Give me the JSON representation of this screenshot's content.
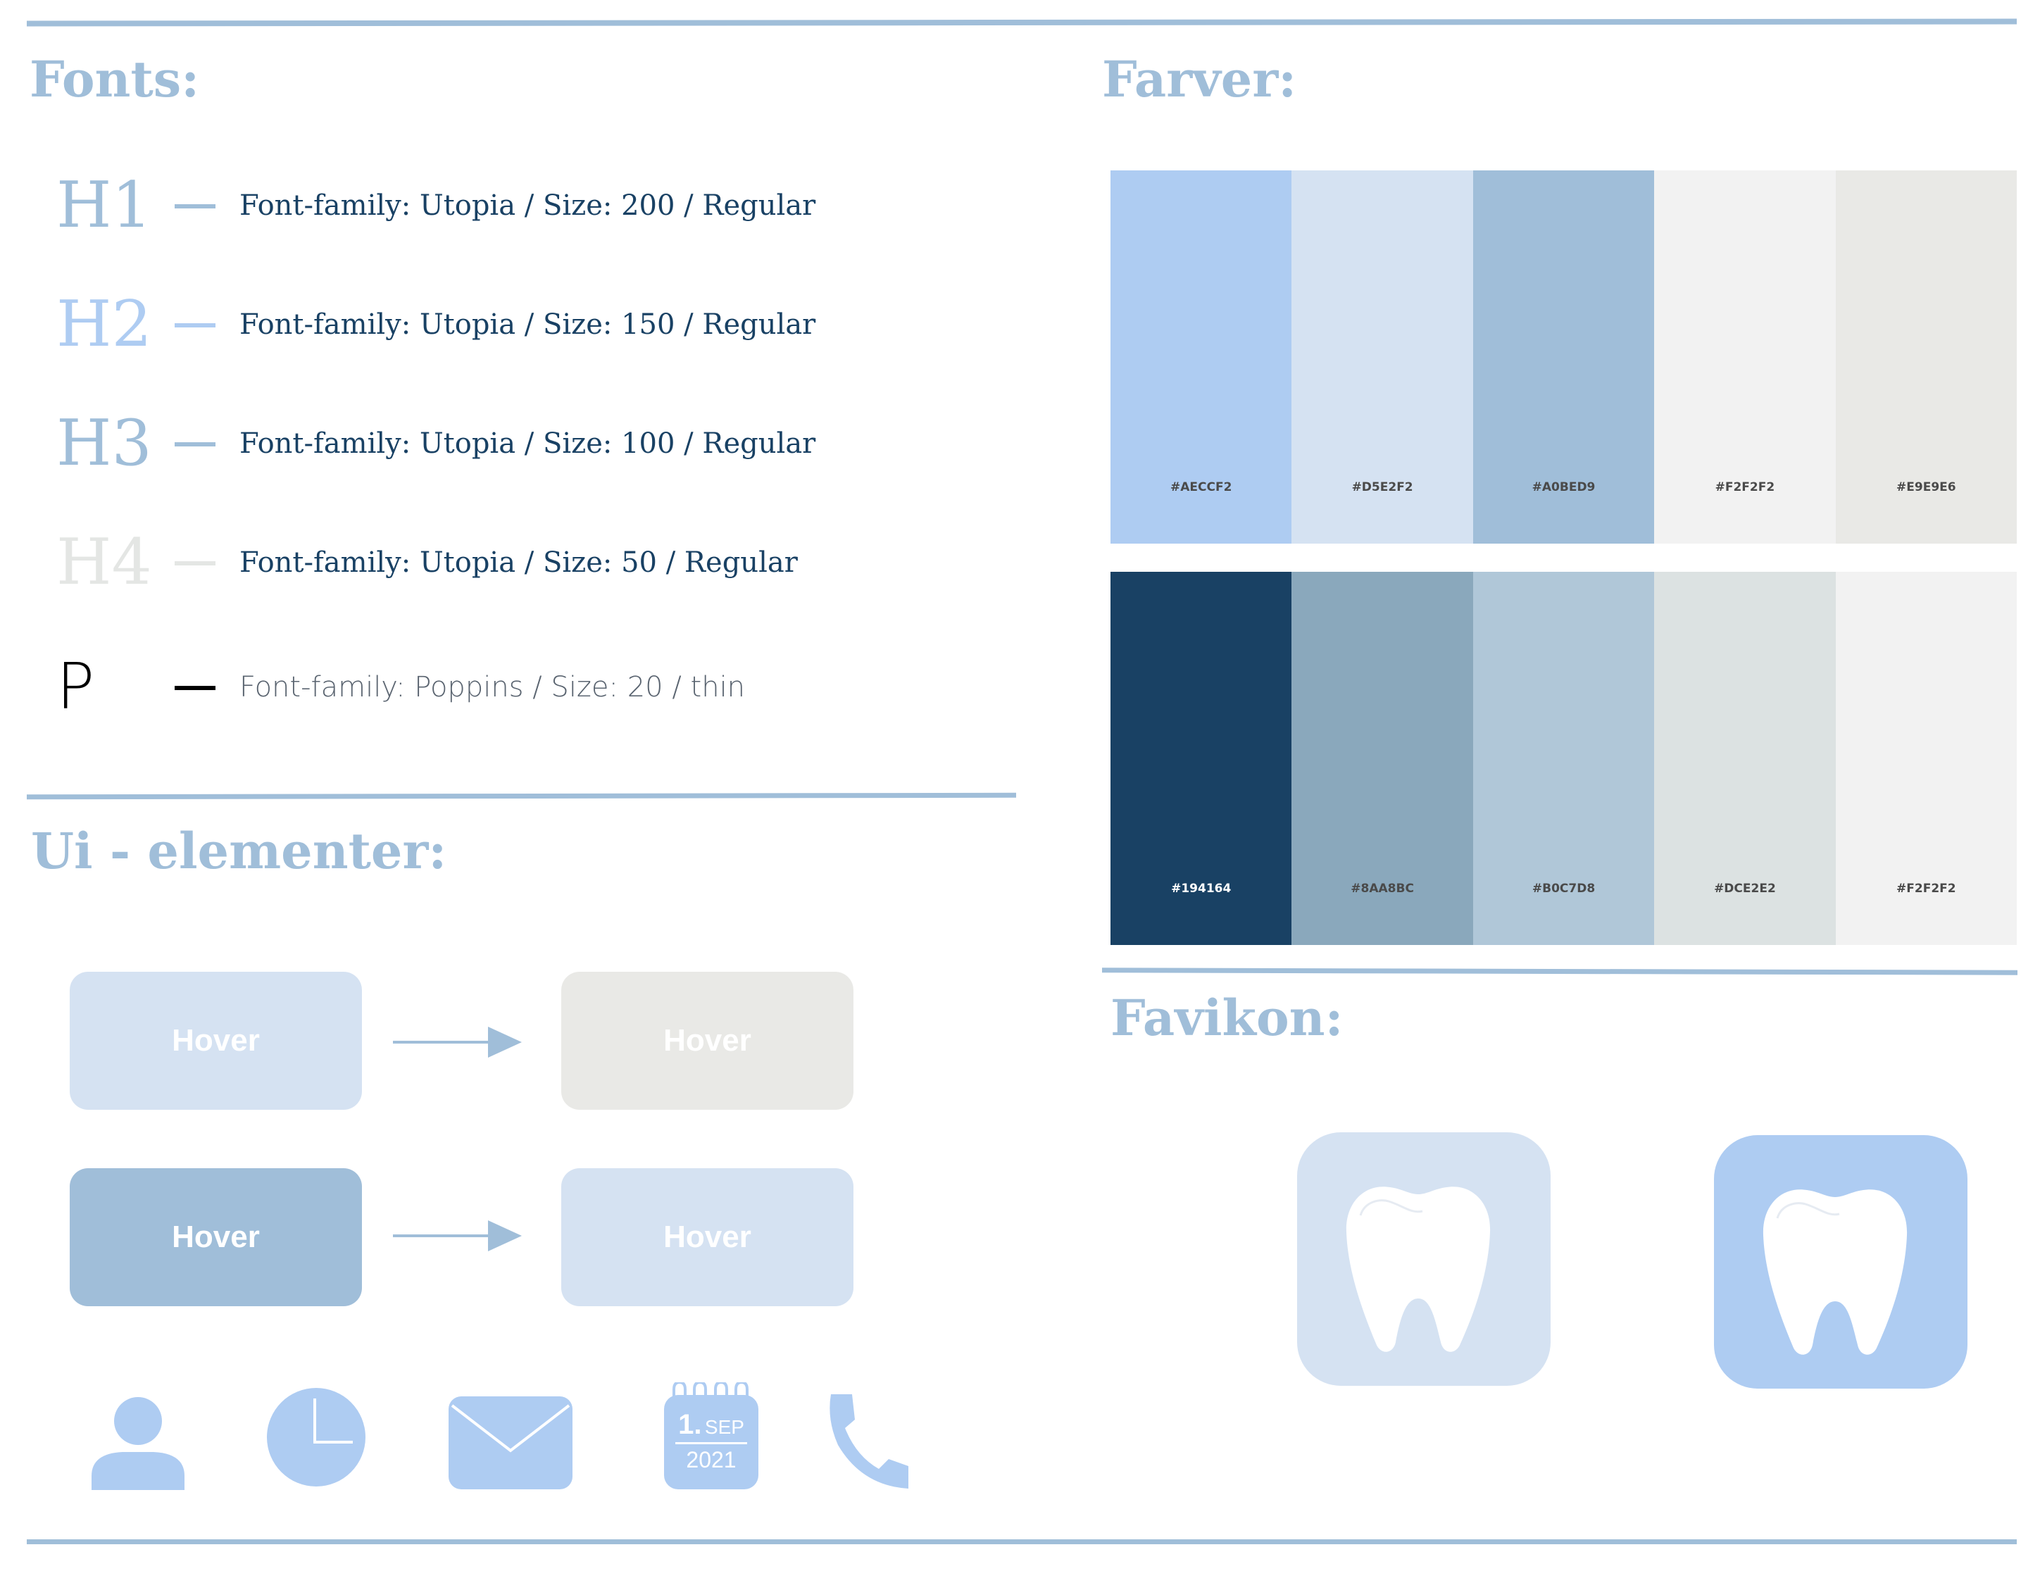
{
  "fonts": {
    "title": "Fonts:",
    "rows": [
      {
        "tag": "H1",
        "desc": "Font-family: Utopia / Size: 200 / Regular",
        "color": "#A0BED9"
      },
      {
        "tag": "H2",
        "desc": "Font-family: Utopia / Size: 150 / Regular",
        "color": "#AECCF2"
      },
      {
        "tag": "H3",
        "desc": "Font-family: Utopia / Size: 100 / Regular",
        "color": "#A0BED9"
      },
      {
        "tag": "H4",
        "desc": "Font-family: Utopia / Size: 50 / Regular",
        "color": "#E9E9E6"
      },
      {
        "tag": "P",
        "desc": "Font-family: Poppins / Size: 20 / thin",
        "color": "#000000"
      }
    ]
  },
  "colors": {
    "title": "Farver:",
    "row1": [
      "#AECCF2",
      "#D5E2F2",
      "#A0BED9",
      "#F2F2F2",
      "#E9E9E6"
    ],
    "row2": [
      "#194164",
      "#8AA8BC",
      "#B0C7D8",
      "#DCE2E2",
      "#F2F2F2"
    ]
  },
  "ui": {
    "title": "Ui - elementer:",
    "buttons": [
      {
        "label": "Hover",
        "color": "#D5E2F2"
      },
      {
        "label": "Hover",
        "color": "#E9E9E6"
      },
      {
        "label": "Hover",
        "color": "#A0BED9"
      },
      {
        "label": "Hover",
        "color": "#D5E2F2"
      }
    ],
    "icons": [
      "user-icon",
      "clock-icon",
      "mail-icon",
      "calendar-icon",
      "phone-icon"
    ],
    "calendar": {
      "day": "1.",
      "month": "SEP",
      "year": "2021"
    }
  },
  "favicon": {
    "title": "Favikon:",
    "icons": [
      {
        "name": "tooth-favicon-light",
        "bg": "#D5E2F2"
      },
      {
        "name": "tooth-favicon-blue",
        "bg": "#AECCF2"
      }
    ]
  },
  "palette": {
    "rule": "#A0BED9",
    "arrow": "#A0BED9",
    "icon": "#AECCF2",
    "text": "#194164"
  }
}
